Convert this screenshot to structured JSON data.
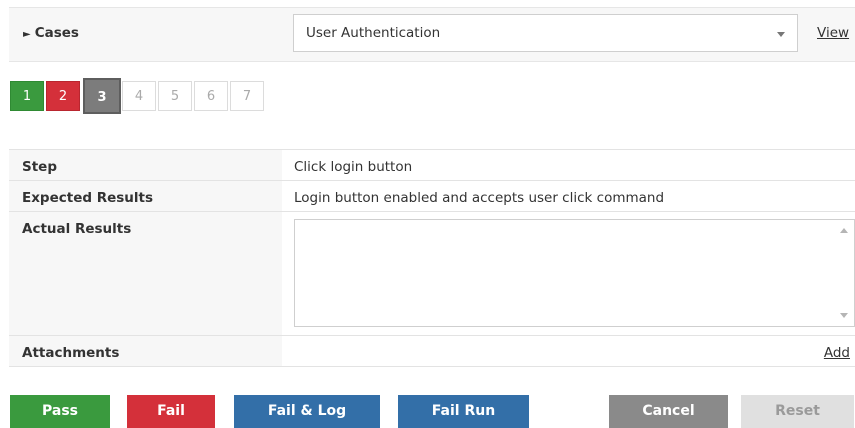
{
  "cases": {
    "label": "Cases",
    "arrow": "►",
    "selected_case": "User Authentication",
    "view_label": "View"
  },
  "pager": {
    "pages": [
      {
        "label": "1",
        "status": "pass"
      },
      {
        "label": "2",
        "status": "fail"
      },
      {
        "label": "3",
        "status": "current"
      },
      {
        "label": "4",
        "status": "todo"
      },
      {
        "label": "5",
        "status": "todo"
      },
      {
        "label": "6",
        "status": "todo"
      },
      {
        "label": "7",
        "status": "todo"
      }
    ]
  },
  "details": {
    "step_label": "Step",
    "step_value": "Click login button",
    "expected_label": "Expected Results",
    "expected_value": "Login button enabled and accepts user click command",
    "actual_label": "Actual Results",
    "actual_value": "",
    "attachments_label": "Attachments",
    "add_label": "Add"
  },
  "actions": {
    "pass": "Pass",
    "fail": "Fail",
    "fail_log": "Fail & Log",
    "fail_run": "Fail Run",
    "cancel": "Cancel",
    "reset": "Reset"
  },
  "colors": {
    "pass": "#3a9a3e",
    "fail": "#d4303a",
    "primary": "#336fa8",
    "current": "#7c7c7c",
    "disabled": "#e0e0e0"
  }
}
